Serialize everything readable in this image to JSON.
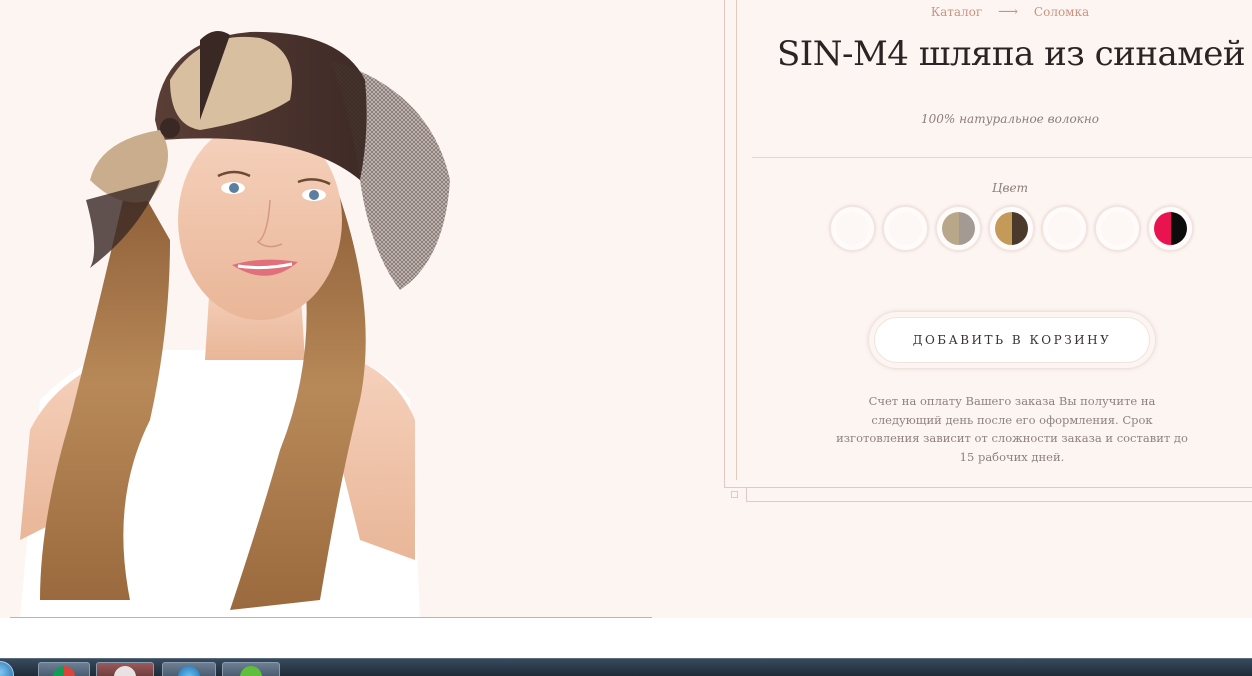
{
  "breadcrumb": {
    "items": [
      "Каталог",
      "Соломка"
    ],
    "separator": "⟶"
  },
  "product": {
    "title": "SIN-M4 шляпа из синамей",
    "subtitle": "100% натуральное волокно",
    "color_label": "Цвет",
    "swatches": [
      {
        "name": "white-1",
        "left": "#fdf8f6",
        "right": "#fdf8f6"
      },
      {
        "name": "white-2",
        "left": "#fdf8f6",
        "right": "#fdf8f6"
      },
      {
        "name": "beige-grey",
        "left": "#b9a78a",
        "right": "#a39a94"
      },
      {
        "name": "camel-brown",
        "left": "#c49a59",
        "right": "#4b3a2c"
      },
      {
        "name": "white-3",
        "left": "#fdf8f6",
        "right": "#fdf8f6"
      },
      {
        "name": "white-4",
        "left": "#fdf8f6",
        "right": "#fdf8f6"
      },
      {
        "name": "red-black",
        "left": "#e8134f",
        "right": "#0c0c0c"
      }
    ],
    "add_to_cart": "ДОБАВИТЬ В КОРЗИНУ",
    "note": "Счет на оплату Вашего заказа Вы получите на следующий день после его оформления. Срок изготовления зависит от сложности заказа и составит до 15 рабочих дней."
  },
  "colors": {
    "background": "#fdf5f2",
    "accent": "#c9947f",
    "title": "#2b2424"
  }
}
